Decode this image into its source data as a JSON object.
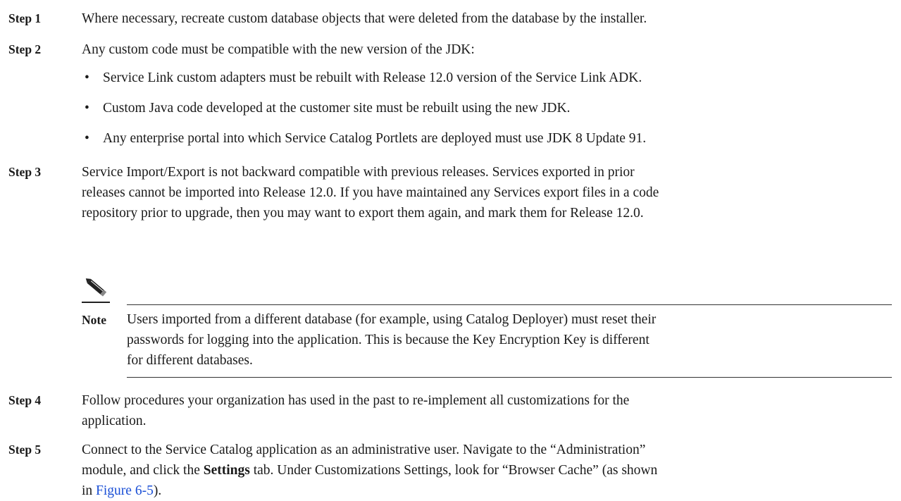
{
  "steps": [
    {
      "label": "Step 1",
      "text": "Where necessary, recreate custom database objects that were deleted from the database by the installer."
    },
    {
      "label": "Step 2",
      "text": "Any custom code must be compatible with the new version of the JDK:",
      "bullets": [
        "Service Link custom adapters must be rebuilt with Release 12.0 version of the Service Link ADK.",
        "Custom Java code developed at the customer site must be rebuilt using the new JDK.",
        "Any enterprise portal into which Service Catalog Portlets are deployed must use JDK 8 Update 91."
      ]
    },
    {
      "label": "Step 3",
      "lines": [
        "Service Import/Export is not backward compatible with previous releases. Services exported in prior",
        "releases cannot be imported into Release 12.0. If you have maintained any Services export files in a code",
        "repository prior to upgrade, then you may want to export them again, and mark them for Release 12.0."
      ]
    },
    {
      "label": "Step 4",
      "lines": [
        "Follow procedures your organization has used in the past to re-implement all customizations for the",
        "application."
      ]
    },
    {
      "label": "Step 5",
      "line1": "Connect to the Service Catalog application as an administrative user. Navigate to the “Administration”",
      "line2_pre": "module, and click the ",
      "line2_bold": "Settings",
      "line2_post": " tab. Under Customizations Settings, look for “Browser Cache” (as shown",
      "line3_pre": "in ",
      "line3_link": "Figure 6-5",
      "line3_post": ")."
    }
  ],
  "note": {
    "label": "Note",
    "lines": [
      "Users imported from a different database (for example, using Catalog Deployer) must reset their",
      "passwords for logging into the application. This is because the Key Encryption Key is different",
      "for different databases."
    ]
  },
  "colors": {
    "link": "#1a4fd6",
    "text": "#1a1a1a"
  },
  "icons": {
    "bullet": "•",
    "note": "pencil-icon"
  }
}
